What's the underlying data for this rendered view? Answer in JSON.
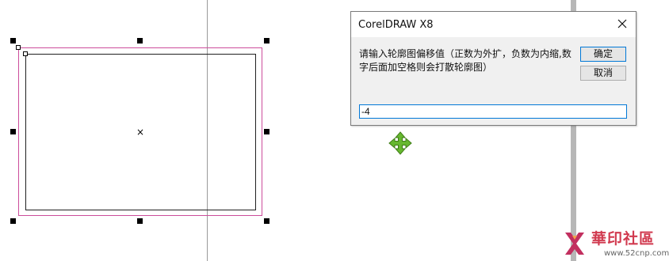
{
  "dialog": {
    "title": "CorelDRAW X8",
    "message": "请输入轮廓图偏移值（正数为外扩，负数为内缩,数字后面加空格则会打散轮廓图）",
    "ok_label": "确定",
    "cancel_label": "取消",
    "input_value": "-4"
  },
  "watermark": {
    "title": "華印社區",
    "url": "www.52cnp.com"
  },
  "colors": {
    "outline": "#cc4d9b",
    "accent": "#0078d7",
    "cursor": "#66b82f",
    "watermark": "#d13a4f"
  },
  "icons": {
    "close": "close-icon",
    "move_cursor": "move-cursor-icon",
    "center_mark": "center-mark-icon",
    "logo": "logo-icon"
  }
}
